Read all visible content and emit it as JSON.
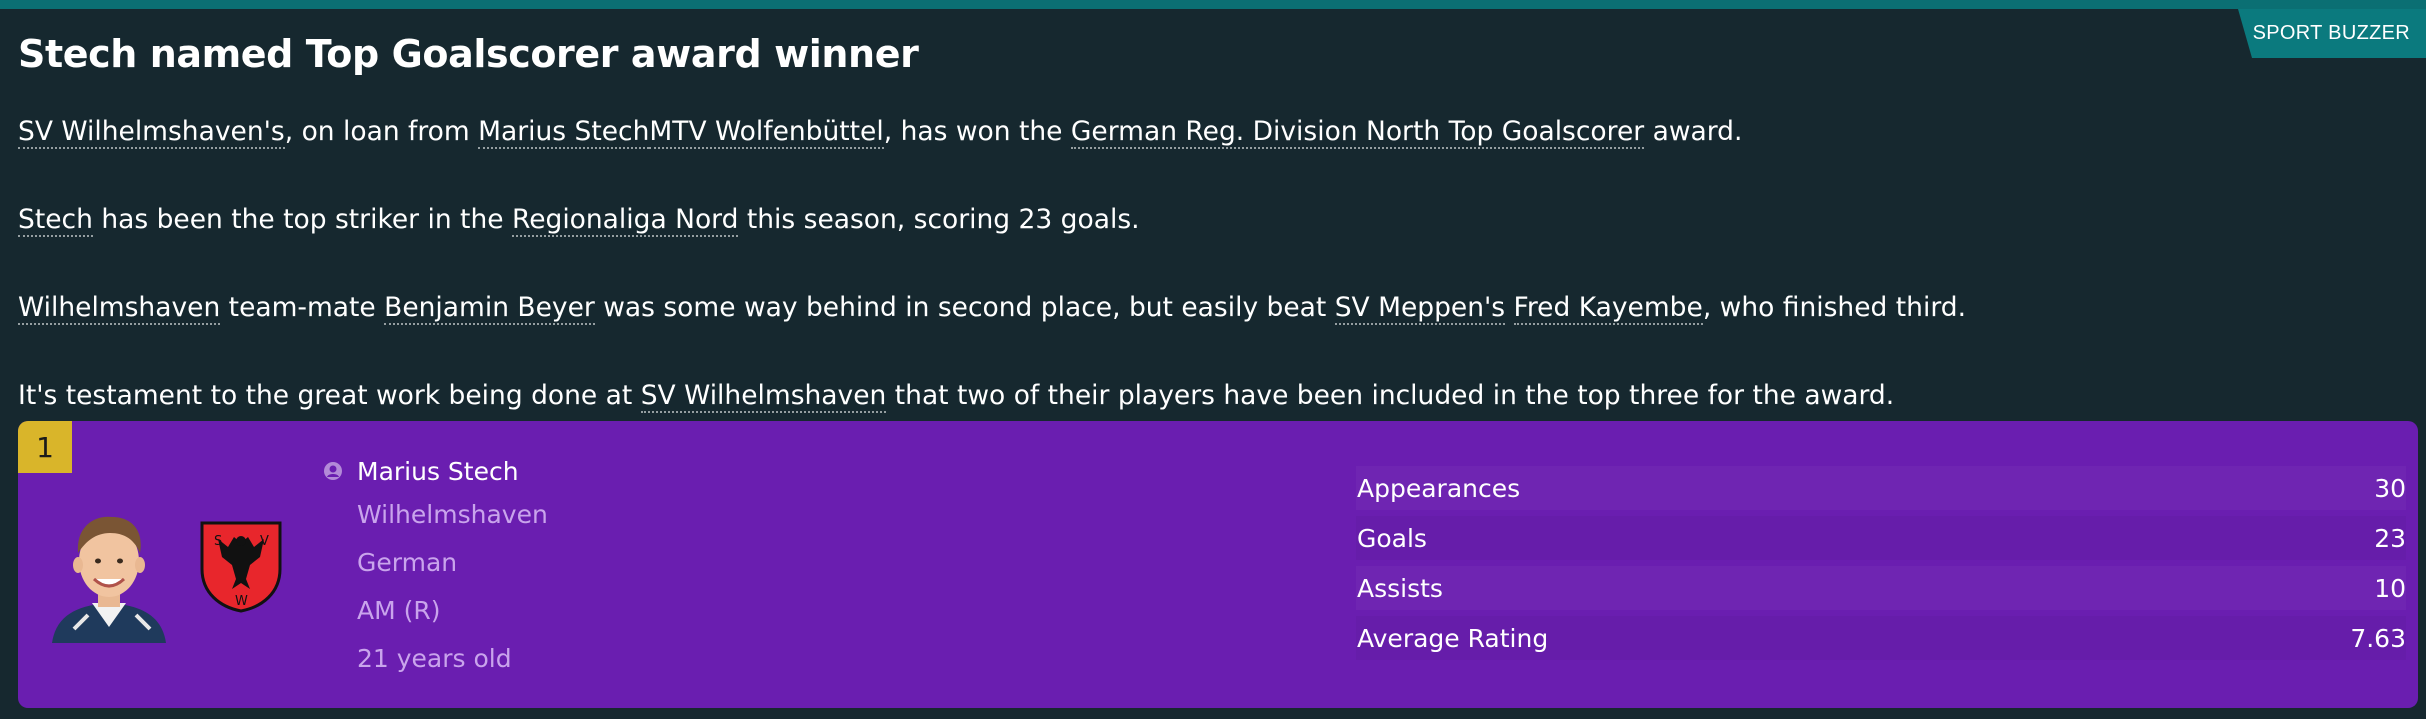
{
  "source": "SPORT BUZZER",
  "headline": "Stech named Top Goalscorer award winner",
  "article": {
    "p1": {
      "club": "SV Wilhelmshaven's",
      "player": "Marius Stech",
      "t1": ", on loan from ",
      "loan_club": "MTV Wolfenbüttel",
      "t2": ", has won the ",
      "award": "German Reg. Division North Top Goalscorer",
      "t3": " award."
    },
    "p2": {
      "player": "Stech",
      "t1": " has been the top striker in the ",
      "league": "Regionaliga Nord",
      "t2": " this season, scoring 23 goals."
    },
    "p3": {
      "club": "Wilhelmshaven",
      "t1": " team-mate ",
      "player2": "Benjamin Beyer",
      "t2": " was some way behind in second place, but easily beat ",
      "club3": "SV Meppen's",
      "t3": " ",
      "player3": "Fred Kayembe",
      "t4": ", who finished third."
    },
    "p4": {
      "t1": "It's testament to the great work being done at ",
      "club": "SV Wilhelmshaven",
      "t2": " that two of their players have been included in the top three for the award."
    }
  },
  "card": {
    "rank": "1",
    "player_name": "Marius Stech",
    "club": "Wilhelmshaven",
    "nationality": "German",
    "position": "AM (R)",
    "age": "21 years old",
    "crest_letters": [
      "S",
      "V",
      "W"
    ],
    "stats": [
      {
        "label": "Appearances",
        "value": "30"
      },
      {
        "label": "Goals",
        "value": "23"
      },
      {
        "label": "Assists",
        "value": "10"
      },
      {
        "label": "Average Rating",
        "value": "7.63"
      }
    ]
  },
  "icons": {
    "player": "person-icon",
    "crest": "club-crest-icon",
    "photo": "player-photo"
  },
  "colors": {
    "background": "#16282f",
    "accent_teal": "#0b7a7e",
    "card_purple": "#6a1eb0",
    "rank_gold": "#d9b52a",
    "muted_text": "#c9a4ec",
    "crest_red": "#e8262c"
  }
}
